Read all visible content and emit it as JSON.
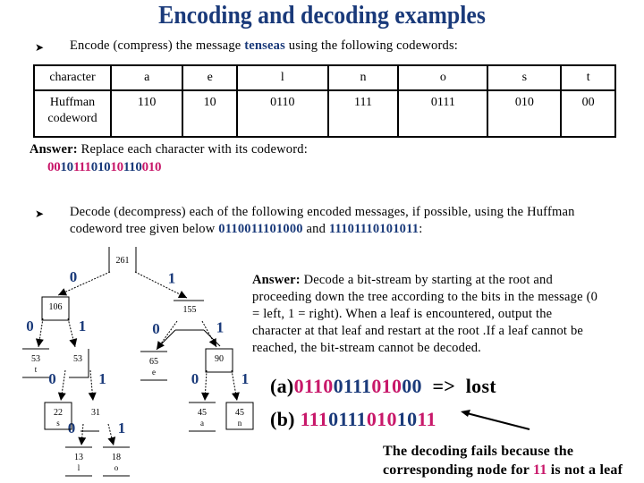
{
  "title": "Encoding and decoding examples",
  "bullets": {
    "encode": {
      "prefix": "Encode (compress) the message ",
      "message": "tenseas",
      "suffix": " using the following codewords:"
    },
    "decode": {
      "line1": "Decode (decompress) each of the following encoded messages, if possible, using the Huffman",
      "line2_prefix": "codeword tree given below ",
      "msg_a": "0110011101000",
      "line2_mid": " and ",
      "msg_b": "11101110101011",
      "line2_suffix": ":"
    }
  },
  "table": {
    "header_label": "character",
    "row_label_line1": "Huffman",
    "row_label_line2": "codeword",
    "columns": [
      {
        "char": "a",
        "code": "110"
      },
      {
        "char": "e",
        "code": "10"
      },
      {
        "char": "l",
        "code": "0110"
      },
      {
        "char": "n",
        "code": "111"
      },
      {
        "char": "o",
        "code": "0111"
      },
      {
        "char": "s",
        "code": "010"
      },
      {
        "char": "t",
        "code": "00"
      }
    ]
  },
  "encode_answer": {
    "label": "Answer:",
    "text": " Replace each character with its codeword:",
    "segments": [
      {
        "bits": "00",
        "color": "pink"
      },
      {
        "bits": "10",
        "color": "blue"
      },
      {
        "bits": "111",
        "color": "pink"
      },
      {
        "bits": "010",
        "color": "blue"
      },
      {
        "bits": "10",
        "color": "pink"
      },
      {
        "bits": "110",
        "color": "blue"
      },
      {
        "bits": "010",
        "color": "pink"
      }
    ]
  },
  "decode_answer": {
    "label": "Answer:",
    "lines": [
      " Decode a bit-stream by starting at the root and",
      "proceeding down the tree according to the bits in the message (0",
      "= left, 1 = right).  When a leaf is encountered, output the",
      "character at that leaf and restart at the root .If a leaf cannot be",
      "reached, the bit-stream cannot be decoded."
    ]
  },
  "result_a": {
    "label": "(a)",
    "segments": [
      {
        "bits": "0110",
        "color": "pink"
      },
      {
        "bits": "0111",
        "color": "blue"
      },
      {
        "bits": "010",
        "color": "pink"
      },
      {
        "bits": "00",
        "color": "blue"
      }
    ],
    "arrow_text": "  =>  lost"
  },
  "result_b": {
    "label": "(b) ",
    "segments": [
      {
        "bits": "111",
        "color": "pink"
      },
      {
        "bits": "0111",
        "color": "blue"
      },
      {
        "bits": "010",
        "color": "pink"
      },
      {
        "bits": "10",
        "color": "blue"
      },
      {
        "bits": "11",
        "color": "pink"
      }
    ]
  },
  "fail_note": {
    "line1": "The decoding fails because the",
    "line2_prefix": "corresponding node for ",
    "line2_code": "11",
    "line2_suffix": " is not a leaf"
  },
  "colors": {
    "title": "#1a3a7a",
    "pink": "#c8186a",
    "blue": "#1a3a7a"
  },
  "tree": {
    "nodes": [
      {
        "id": "root",
        "weight": "261",
        "char": ""
      },
      {
        "id": "n106",
        "weight": "106",
        "char": ""
      },
      {
        "id": "n155",
        "weight": "155",
        "char": ""
      },
      {
        "id": "t",
        "weight": "53",
        "char": "t"
      },
      {
        "id": "n53",
        "weight": "53",
        "char": ""
      },
      {
        "id": "e",
        "weight": "65",
        "char": "e"
      },
      {
        "id": "n90",
        "weight": "90",
        "char": ""
      },
      {
        "id": "s",
        "weight": "22",
        "char": "s"
      },
      {
        "id": "n31",
        "weight": "31",
        "char": ""
      },
      {
        "id": "a",
        "weight": "45",
        "char": "a"
      },
      {
        "id": "n",
        "weight": "45",
        "char": "n"
      },
      {
        "id": "l",
        "weight": "13",
        "char": "l"
      },
      {
        "id": "o",
        "weight": "18",
        "char": "o"
      }
    ],
    "edges": [
      {
        "from": "root",
        "to": "n106",
        "bit": "0"
      },
      {
        "from": "root",
        "to": "n155",
        "bit": "1"
      },
      {
        "from": "n106",
        "to": "t",
        "bit": "0"
      },
      {
        "from": "n106",
        "to": "n53",
        "bit": "1"
      },
      {
        "from": "n155",
        "to": "e",
        "bit": "0"
      },
      {
        "from": "n155",
        "to": "n90",
        "bit": "1"
      },
      {
        "from": "n53",
        "to": "s",
        "bit": "0"
      },
      {
        "from": "n53",
        "to": "n31",
        "bit": "1"
      },
      {
        "from": "n90",
        "to": "a",
        "bit": "0"
      },
      {
        "from": "n90",
        "to": "n",
        "bit": "1"
      },
      {
        "from": "n31",
        "to": "l",
        "bit": "0"
      },
      {
        "from": "n31",
        "to": "o",
        "bit": "1"
      }
    ]
  }
}
